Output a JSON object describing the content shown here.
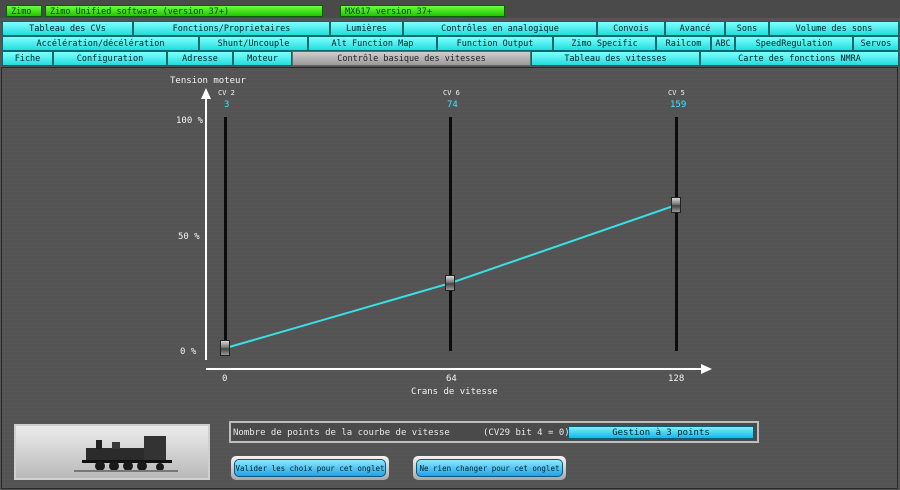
{
  "header": {
    "app_name": "Zimo",
    "software": "Zimo Unified software (version 37+)",
    "decoder": "MX617 version 37+"
  },
  "tabs": {
    "row1": [
      "Tableau des CVs",
      "Fonctions/Proprietaires",
      "Lumières",
      "Contrôles en analogique",
      "Convois",
      "Avancé",
      "Sons",
      "Volume des sons"
    ],
    "row2": [
      "Accélération/décélération",
      "Shunt/Uncouple",
      "Alt Function Map",
      "Function Output",
      "Zimo Specific",
      "Railcom",
      "ABC",
      "SpeedRegulation",
      "Servos"
    ],
    "row3": [
      "Fiche",
      "Configuration",
      "Adresse",
      "Moteur",
      "Contrôle basique des vitesses",
      "Tableau des vitesses",
      "Carte des fonctions NMRA"
    ],
    "active": "Contrôle basique des vitesses"
  },
  "chart": {
    "y_axis_title": "Tension moteur",
    "y_ticks": [
      "100 %",
      "50 %",
      "0 %"
    ],
    "x_axis_title": "Crans de vitesse",
    "x_ticks": [
      "0",
      "64",
      "128"
    ],
    "sliders": [
      {
        "label": "CV 2",
        "value": "3"
      },
      {
        "label": "CV 6",
        "value": "74"
      },
      {
        "label": "CV 5",
        "value": "159"
      }
    ],
    "line_color": "#39e0e6"
  },
  "chart_data": {
    "type": "line",
    "x": [
      0,
      64,
      128
    ],
    "values": [
      3,
      74,
      159
    ],
    "title": "",
    "xlabel": "Crans de vitesse",
    "ylabel": "Tension moteur",
    "xlim": [
      0,
      128
    ],
    "ylim": [
      0,
      255
    ]
  },
  "footer": {
    "points_label": "Nombre de points de la courbe de vitesse",
    "cv29_note": "(CV29 bit 4 = 0)",
    "gestion_button": "Gestion à 3 points",
    "validate_button": "Valider les choix pour cet onglet",
    "cancel_button": "Ne rien changer pour cet onglet"
  }
}
